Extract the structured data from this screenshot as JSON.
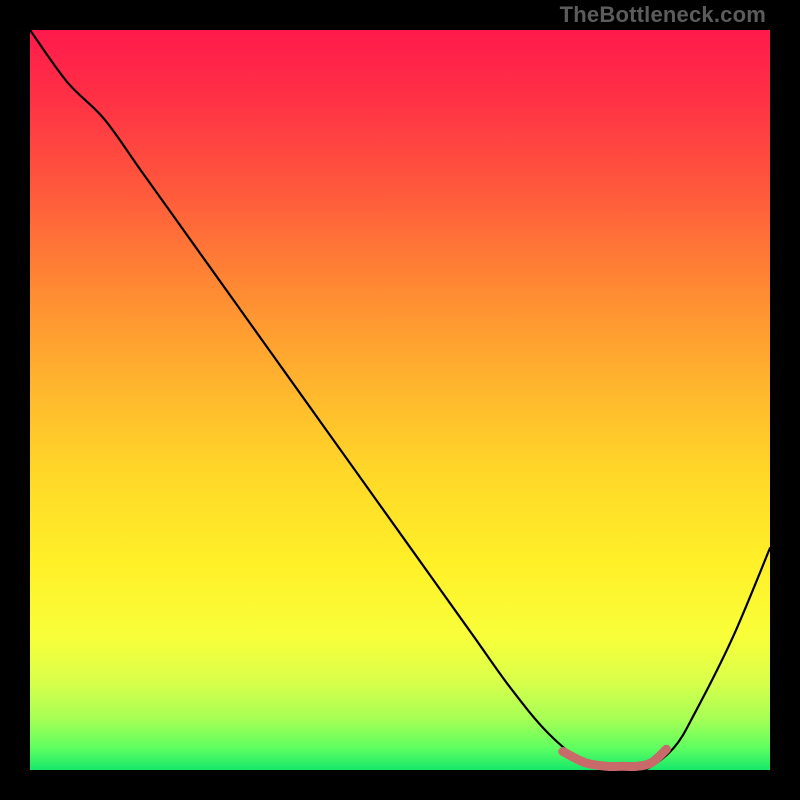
{
  "watermark": "TheBottleneck.com",
  "chart_data": {
    "type": "line",
    "title": "",
    "xlabel": "",
    "ylabel": "",
    "xlim": [
      0,
      100
    ],
    "ylim": [
      0,
      100
    ],
    "grid": false,
    "legend": false,
    "background": "rainbow-vertical-gradient (red → orange → yellow → green)",
    "series": [
      {
        "name": "bottleneck-curve",
        "color": "#000000",
        "x": [
          0,
          5,
          10,
          15,
          20,
          25,
          30,
          35,
          40,
          45,
          50,
          55,
          60,
          65,
          70,
          75,
          80,
          83,
          87,
          90,
          95,
          100
        ],
        "values": [
          100,
          93,
          88,
          81,
          74,
          67,
          60,
          53,
          46,
          39,
          32,
          25,
          18,
          11,
          5,
          1,
          0,
          0,
          3,
          8,
          18,
          30
        ]
      },
      {
        "name": "optimal-zone-marker",
        "color": "#c96a6a",
        "x": [
          72,
          75,
          78,
          80,
          82,
          84,
          86
        ],
        "values": [
          2.5,
          1.0,
          0.5,
          0.5,
          0.5,
          1.0,
          2.8
        ]
      }
    ]
  }
}
